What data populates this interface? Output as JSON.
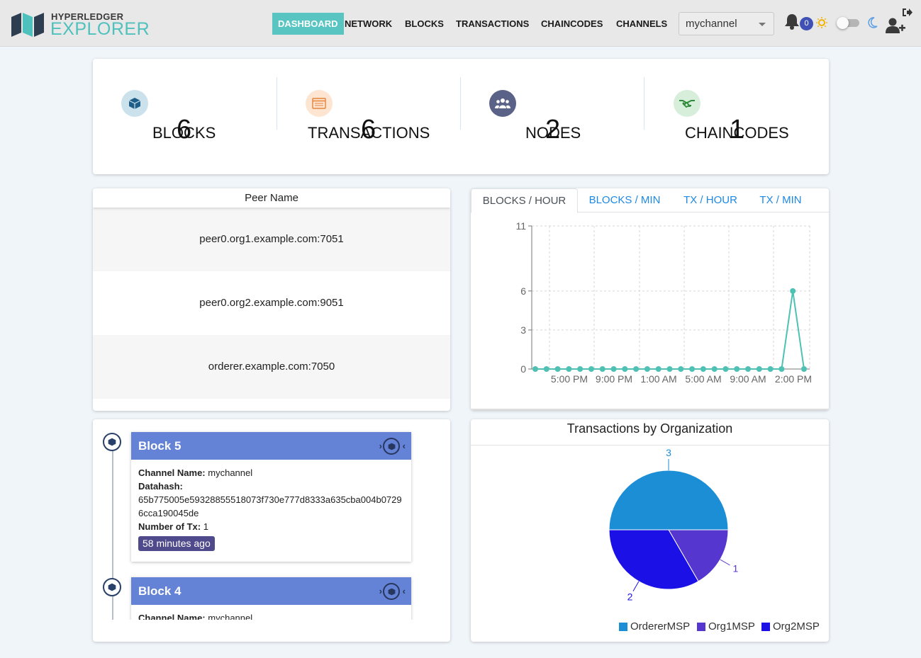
{
  "header": {
    "logo_top": "HYPERLEDGER",
    "logo_bottom": "EXPLORER",
    "nav": [
      "DASHBOARD",
      "NETWORK",
      "BLOCKS",
      "TRANSACTIONS",
      "CHAINCODES",
      "CHANNELS"
    ],
    "active_nav": "DASHBOARD",
    "channel": "mychannel",
    "notification_count": "0",
    "icons": [
      "bell-icon",
      "sun-icon",
      "theme-toggle",
      "moon-icon",
      "logout-icon",
      "add-user-icon"
    ]
  },
  "stats": [
    {
      "value": "6",
      "label": "BLOCKS",
      "icon": "cube-icon",
      "icon_bg": "#cbe1ec",
      "icon_color": "#1f5e89"
    },
    {
      "value": "6",
      "label": "TRANSACTIONS",
      "icon": "list-icon",
      "icon_bg": "#fde5d1",
      "icon_color": "#e5833b"
    },
    {
      "value": "2",
      "label": "NODES",
      "icon": "users-icon",
      "icon_bg": "#5a6287",
      "icon_color": "#ffffff"
    },
    {
      "value": "1",
      "label": "CHAINCODES",
      "icon": "handshake-icon",
      "icon_bg": "#d7eedb",
      "icon_color": "#2e8b3a"
    }
  ],
  "peers": {
    "header": "Peer Name",
    "rows": [
      "peer0.org1.example.com:7051",
      "peer0.org2.example.com:9051",
      "orderer.example.com:7050"
    ]
  },
  "chart_tabs": [
    "BLOCKS / HOUR",
    "BLOCKS / MIN",
    "TX / HOUR",
    "TX / MIN"
  ],
  "active_chart_tab": "BLOCKS / HOUR",
  "blocks": [
    {
      "title": "Block 5",
      "channel_label": "Channel Name:",
      "channel": "mychannel",
      "datahash_label": "Datahash:",
      "datahash": "65b775005e59328855518073f730e777d8333a635cba004b07296cca190045de",
      "tx_label": "Number of Tx:",
      "tx": "1",
      "age": "58 minutes ago"
    },
    {
      "title": "Block 4",
      "channel_label": "Channel Name:",
      "channel": "mychannel"
    }
  ],
  "pie_title": "Transactions by Organization",
  "colors": {
    "accent": "#58c5c2",
    "line": "#4fc1b4",
    "block_header": "#6482d6",
    "age_badge": "#4f4a8c"
  },
  "chart_data": [
    {
      "type": "line",
      "ylim": [
        0,
        11
      ],
      "yticks": [
        "0",
        "3",
        "6",
        "11"
      ],
      "xtick_labels": [
        "5:00 PM",
        "9:00 PM",
        "1:00 AM",
        "5:00 AM",
        "9:00 AM",
        "2:00 PM"
      ],
      "grid": true,
      "series": [
        {
          "values": [
            0,
            0,
            0,
            0,
            0,
            0,
            0,
            0,
            0,
            0,
            0,
            0,
            0,
            0,
            0,
            0,
            0,
            0,
            0,
            0,
            0,
            0,
            0,
            6,
            0
          ]
        }
      ]
    },
    {
      "type": "pie",
      "title": "Transactions by Organization",
      "legend_position": "bottom",
      "slices": [
        {
          "name": "OrdererMSP",
          "value": 3,
          "color": "#1b8ed6"
        },
        {
          "name": "Org1MSP",
          "value": 1,
          "color": "#5536cf"
        },
        {
          "name": "Org2MSP",
          "value": 2,
          "color": "#1b10e6"
        }
      ]
    }
  ]
}
